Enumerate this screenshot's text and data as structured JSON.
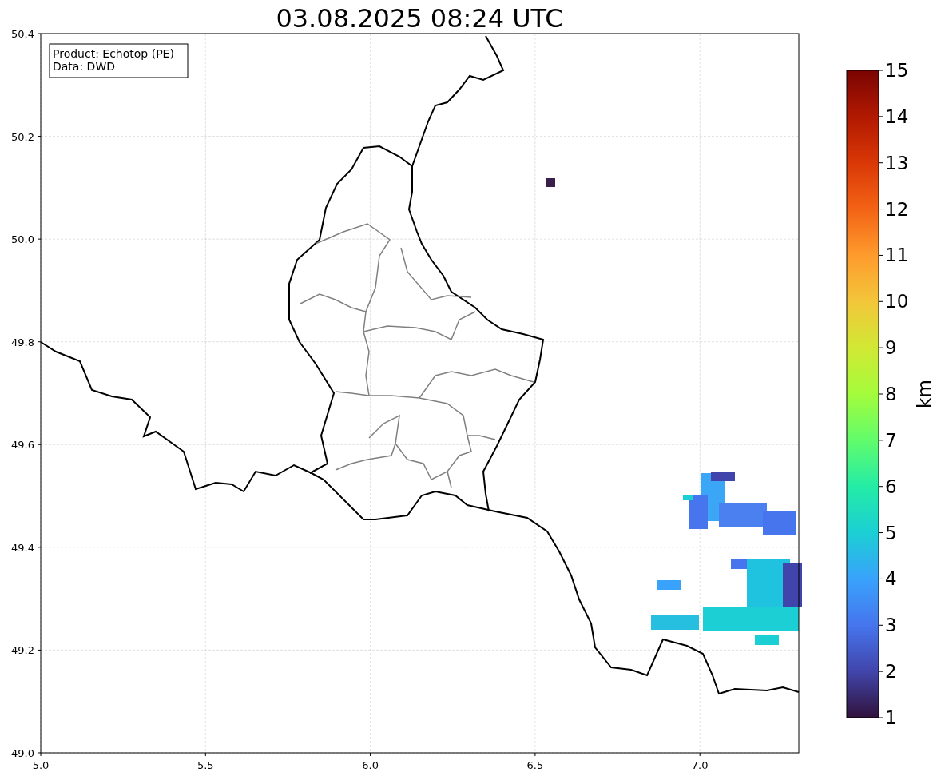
{
  "title": "03.08.2025 08:24 UTC",
  "info_box": [
    "Product: Echotop (PE)",
    "Data: DWD"
  ],
  "map": {
    "xticks": [
      "5.0",
      "5.5",
      "6.0",
      "6.5",
      "7.0"
    ],
    "yticks": [
      "50.4",
      "50.2",
      "50.0",
      "49.8",
      "49.6",
      "49.4",
      "49.2",
      "49.0"
    ]
  },
  "colorbar": {
    "label": "km",
    "ticks": [
      "15",
      "14",
      "13",
      "12",
      "11",
      "10",
      "9",
      "8",
      "7",
      "6",
      "5",
      "4",
      "3",
      "2",
      "1"
    ]
  }
}
